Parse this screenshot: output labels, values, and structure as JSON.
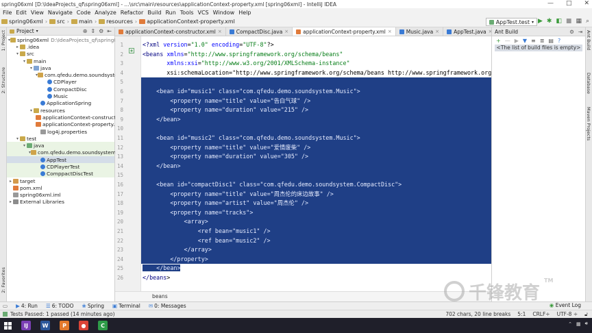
{
  "titlebar": {
    "title": "spring06xml [D:\\IdeaProjects_qf\\spring06xml] - ...\\src\\main\\resources\\applicationContext-property.xml [spring06xml] - IntelliJ IDEA",
    "min": "—",
    "max": "□",
    "close": "✕"
  },
  "menu": [
    "File",
    "Edit",
    "View",
    "Navigate",
    "Code",
    "Analyze",
    "Refactor",
    "Build",
    "Run",
    "Tools",
    "VCS",
    "Window",
    "Help"
  ],
  "navbar": {
    "crumbs": [
      "spring06xml",
      "src",
      "main",
      "resources",
      "applicationContext-property.xml"
    ],
    "run_config": "AppTest.test"
  },
  "project_panel": {
    "title": "Project",
    "tree": [
      {
        "label": "spring06xml",
        "extra": "D:\\IdeaProjects_qf\\spring06xml",
        "indent": 0,
        "arrow": "▾",
        "icon": "folder"
      },
      {
        "label": ".idea",
        "indent": 1,
        "arrow": "▸",
        "icon": "folder"
      },
      {
        "label": "src",
        "indent": 1,
        "arrow": "▾",
        "icon": "folder"
      },
      {
        "label": "main",
        "indent": 2,
        "arrow": "▾",
        "icon": "folder"
      },
      {
        "label": "java",
        "indent": 3,
        "arrow": "▾",
        "icon": "fblue"
      },
      {
        "label": "com.qfedu.demo.soundsystem",
        "indent": 4,
        "arrow": "▾",
        "icon": "pkg"
      },
      {
        "label": "CDPlayer",
        "indent": 5,
        "arrow": "",
        "icon": "class"
      },
      {
        "label": "CompactDisc",
        "indent": 5,
        "arrow": "",
        "icon": "class"
      },
      {
        "label": "Music",
        "indent": 5,
        "arrow": "",
        "icon": "class"
      },
      {
        "label": "ApplicationSpring",
        "indent": 4,
        "arrow": "",
        "icon": "class"
      },
      {
        "label": "resources",
        "indent": 3,
        "arrow": "▾",
        "icon": "folder"
      },
      {
        "label": "applicationContext-constructor.xml",
        "indent": 4,
        "arrow": "",
        "icon": "xml"
      },
      {
        "label": "applicationContext-property.xml",
        "indent": 4,
        "arrow": "",
        "icon": "xml"
      },
      {
        "label": "log4j.properties",
        "indent": 4,
        "arrow": "",
        "icon": "prop"
      },
      {
        "label": "test",
        "indent": 1,
        "arrow": "▾",
        "icon": "folder"
      },
      {
        "label": "java",
        "indent": 2,
        "arrow": "▾",
        "icon": "fgreen",
        "bg": "green"
      },
      {
        "label": "com.qfedu.demo.soundsystem",
        "indent": 3,
        "arrow": "▾",
        "icon": "pkg",
        "bg": "green"
      },
      {
        "label": "AppTest",
        "indent": 4,
        "arrow": "",
        "icon": "class",
        "bg": "sel"
      },
      {
        "label": "CDPlayerTest",
        "indent": 4,
        "arrow": "",
        "icon": "class",
        "bg": "green"
      },
      {
        "label": "ComppactDiscTest",
        "indent": 4,
        "arrow": "",
        "icon": "class",
        "bg": "green"
      },
      {
        "label": "target",
        "indent": 0,
        "arrow": "▸",
        "icon": "forange"
      },
      {
        "label": "pom.xml",
        "indent": 0,
        "arrow": "",
        "icon": "xml"
      },
      {
        "label": "spring06xml.iml",
        "indent": 0,
        "arrow": "",
        "icon": "prop"
      },
      {
        "label": "External Libraries",
        "indent": 0,
        "arrow": "▸",
        "icon": "lib"
      }
    ]
  },
  "tabs": [
    {
      "label": "applicationContext-constructor.xml",
      "icon": "#e07b3b",
      "active": false
    },
    {
      "label": "CompactDisc.java",
      "icon": "#3a7bd5",
      "active": false
    },
    {
      "label": "applicationContext-property.xml",
      "icon": "#e07b3b",
      "active": true
    },
    {
      "label": "Music.java",
      "icon": "#3a7bd5",
      "active": false
    },
    {
      "label": "AppTest.java",
      "icon": "#3a7bd5",
      "active": false
    }
  ],
  "code_lines": [
    {
      "n": "1",
      "text": "<?xml version=\"1.0\" encoding=\"UTF-8\"?>",
      "sel": false
    },
    {
      "n": "2",
      "text": "<beans xmlns=\"http://www.springframework.org/schema/beans\"",
      "sel": false
    },
    {
      "n": "3",
      "text": "       xmlns:xsi=\"http://www.w3.org/2001/XMLSchema-instance\"",
      "sel": false
    },
    {
      "n": "4",
      "text": "       xsi:schemaLocation=\"http://www.springframework.org/schema/beans http://www.springframework.org/s",
      "sel": false
    },
    {
      "n": "5",
      "text": "",
      "sel": true
    },
    {
      "n": "6",
      "text": "    <bean id=\"music1\" class=\"com.qfedu.demo.soundsystem.Music\">",
      "sel": true
    },
    {
      "n": "7",
      "text": "        <property name=\"title\" value=\"告白气球\" />",
      "sel": true
    },
    {
      "n": "8",
      "text": "        <property name=\"duration\" value=\"215\" />",
      "sel": true
    },
    {
      "n": "9",
      "text": "    </bean>",
      "sel": true
    },
    {
      "n": "10",
      "text": "",
      "sel": true
    },
    {
      "n": "11",
      "text": "    <bean id=\"music2\" class=\"com.qfedu.demo.soundsystem.Music\">",
      "sel": true
    },
    {
      "n": "12",
      "text": "        <property name=\"title\" value=\"爱情废柴\" />",
      "sel": true
    },
    {
      "n": "13",
      "text": "        <property name=\"duration\" value=\"305\" />",
      "sel": true
    },
    {
      "n": "14",
      "text": "    </bean>",
      "sel": true
    },
    {
      "n": "15",
      "text": "",
      "sel": true
    },
    {
      "n": "16",
      "text": "    <bean id=\"compactDisc1\" class=\"com.qfedu.demo.soundsystem.CompactDisc\">",
      "sel": true
    },
    {
      "n": "17",
      "text": "        <property name=\"title\" value=\"周杰伦的床边故事\" />",
      "sel": true
    },
    {
      "n": "18",
      "text": "        <property name=\"artist\" value=\"周杰伦\" />",
      "sel": true
    },
    {
      "n": "19",
      "text": "        <property name=\"tracks\">",
      "sel": true
    },
    {
      "n": "20",
      "text": "            <array>",
      "sel": true
    },
    {
      "n": "21",
      "text": "                <ref bean=\"music1\" />",
      "sel": true
    },
    {
      "n": "22",
      "text": "                <ref bean=\"music2\" />",
      "sel": true
    },
    {
      "n": "23",
      "text": "            </array>",
      "sel": true
    },
    {
      "n": "24",
      "text": "        </property>",
      "sel": true
    },
    {
      "n": "25",
      "text": "    </bean>",
      "sel": "partial"
    },
    {
      "n": "26",
      "text": "</beans>",
      "sel": false
    }
  ],
  "editor_breadcrumb": "beans",
  "ant_panel": {
    "title": "Ant Build",
    "empty_text": "<The list of build files is empty>"
  },
  "side_labels": {
    "left": [
      "1: Project",
      "2: Structure",
      "2: Favorites"
    ],
    "right": [
      "Ant Build",
      "Database",
      "Maven Projects"
    ]
  },
  "bottom_tools": [
    {
      "label": "4: Run",
      "icon": "▶"
    },
    {
      "label": "6: TODO",
      "icon": "☰"
    },
    {
      "label": "Spring",
      "icon": "❀"
    },
    {
      "label": "Terminal",
      "icon": "▣"
    },
    {
      "label": "0: Messages",
      "icon": "✉"
    }
  ],
  "event_log": "Event Log",
  "status": {
    "message": "Tests Passed: 1 passed (14 minutes ago)",
    "chars": "702 chars, 20 line breaks",
    "position": "5:1",
    "line_sep": "CRLF÷",
    "encoding": "UTF-8 ÷"
  },
  "taskbar_apps": [
    {
      "name": "intellij",
      "color": "#7b3fb5",
      "glyph": "IJ"
    },
    {
      "name": "word",
      "color": "#2b579a",
      "glyph": "W"
    },
    {
      "name": "presenter",
      "color": "#e3792b",
      "glyph": "P"
    },
    {
      "name": "chrome",
      "color": "#db4437",
      "glyph": "●"
    },
    {
      "name": "camtasia",
      "color": "#2e9b48",
      "glyph": "C"
    }
  ],
  "watermark": {
    "text": "千锋教育",
    "tm": "TM"
  },
  "colors": {
    "selection": "#1f3f86",
    "accent": "#3a7bd5"
  }
}
